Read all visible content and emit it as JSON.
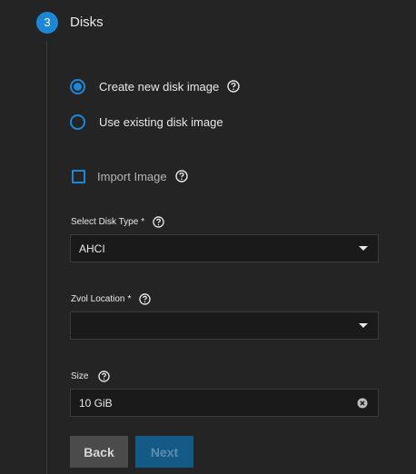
{
  "stepper": {
    "step_number": "3",
    "step_title": "Disks"
  },
  "disk_image_options": [
    {
      "label": "Create new disk image",
      "selected": true
    },
    {
      "label": "Use existing disk image",
      "selected": false
    }
  ],
  "import_image": {
    "label": "Import Image",
    "checked": false
  },
  "select_disk_type": {
    "label": "Select Disk Type",
    "required_marker": "*",
    "value": "AHCI"
  },
  "zvol_location": {
    "label": "Zvol Location",
    "required_marker": "*",
    "value": ""
  },
  "size": {
    "label": "Size",
    "value": "10 GiB"
  },
  "buttons": {
    "back": "Back",
    "next": "Next"
  },
  "colors": {
    "accent": "#1b87d6",
    "background": "#242424",
    "field_background": "#1a1a1a"
  }
}
